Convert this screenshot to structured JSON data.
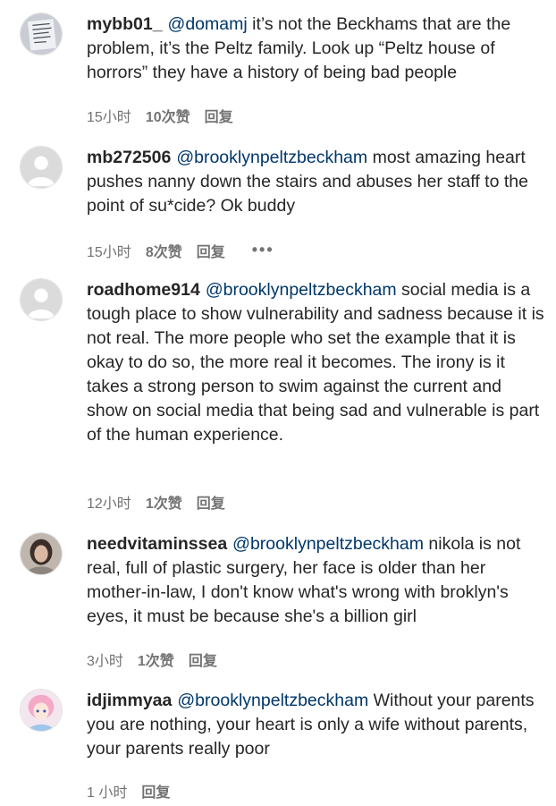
{
  "comments": [
    {
      "username": "mybb01_",
      "mention": "@domamj",
      "text": " it’s not the Beckhams that are the problem, it’s the Peltz family. Look up “Peltz house of horrors” they have a history of being bad people",
      "time": "15小时",
      "likes": "10次赞",
      "reply": "回复",
      "avatar": "avatar-handwritten-note-icon"
    },
    {
      "username": "mb272506",
      "mention": "@brooklynpeltzbeckham",
      "text": " most amazing heart pushes nanny down the stairs and abuses her staff to the point of su*cide? Ok buddy",
      "time": "15小时",
      "likes": "8次赞",
      "reply": "回复",
      "more": "•••",
      "avatar": "default-avatar-icon"
    },
    {
      "username": "roadhome914",
      "mention": "@brooklynpeltzbeckham",
      "text": " social media is a tough place to show vulnerability and sadness because it is not real. The more people who set the example that it is okay to do so, the more real it becomes. The irony is it takes a strong person to swim against the current and show on social media that being sad and vulnerable is part of the human experience.",
      "time": "12小时",
      "likes": "1次赞",
      "reply": "回复",
      "avatar": "default-avatar-icon"
    },
    {
      "username": "needvitaminssea",
      "mention": "@brooklynpeltzbeckham",
      "text": " nikola is not real, full of plastic surgery, her face is older than her mother-in-law, I don't know what's wrong with broklyn's eyes, it must be because she's a billion girl",
      "time": "3小时",
      "likes": "1次赞",
      "reply": "回复",
      "avatar": "avatar-portrait-photo-icon"
    },
    {
      "username": "idjimmyaa",
      "mention": "@brooklynpeltzbeckham",
      "text": " Without your parents you are nothing, your heart is only a wife without parents, your parents really poor",
      "time": "1 小时",
      "reply": "回复",
      "avatar": "avatar-anime-character-icon"
    }
  ],
  "colors": {
    "text": "#262626",
    "mention": "#00376b",
    "meta": "#737373"
  }
}
